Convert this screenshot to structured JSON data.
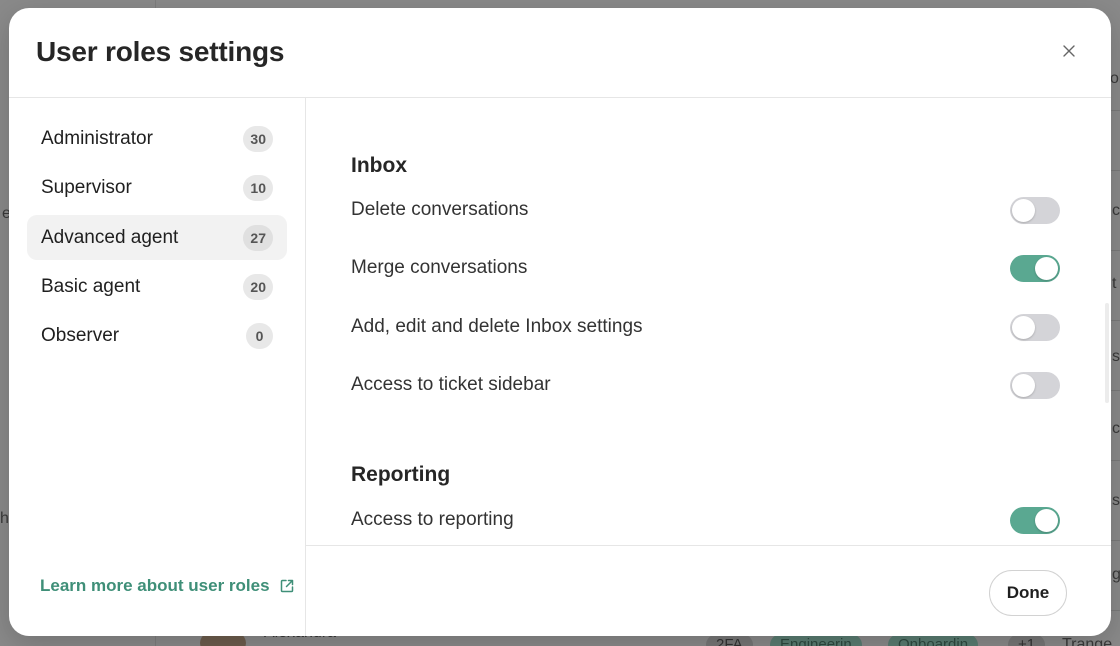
{
  "background": {
    "fragments": [
      "ol",
      "c",
      "t",
      "s",
      "c",
      "s",
      "g",
      "ha",
      "e"
    ],
    "row_name": "Alexandra",
    "tags": [
      "2FA",
      "Engineerin",
      "Onboardin",
      "+1",
      "Trange"
    ]
  },
  "modal": {
    "title": "User roles settings",
    "close_icon": "close-icon"
  },
  "sidebar": {
    "roles": [
      {
        "label": "Administrator",
        "count": "30",
        "active": false
      },
      {
        "label": "Supervisor",
        "count": "10",
        "active": false
      },
      {
        "label": "Advanced agent",
        "count": "27",
        "active": true
      },
      {
        "label": "Basic agent",
        "count": "20",
        "active": false
      },
      {
        "label": "Observer",
        "count": "0",
        "active": false
      }
    ],
    "learn_more": "Learn more about user roles",
    "learn_more_icon": "external-link-icon"
  },
  "content": {
    "sections": [
      {
        "title": "Inbox",
        "permissions": [
          {
            "label": "Delete conversations",
            "enabled": false
          },
          {
            "label": "Merge conversations",
            "enabled": true
          },
          {
            "label": "Add, edit and delete Inbox settings",
            "enabled": false
          },
          {
            "label": "Access to ticket sidebar",
            "enabled": false
          }
        ]
      },
      {
        "title": "Reporting",
        "permissions": [
          {
            "label": "Access to reporting",
            "enabled": true
          }
        ]
      }
    ]
  },
  "footer": {
    "done_label": "Done"
  },
  "colors": {
    "accent": "#5aa891",
    "link": "#3f8f78",
    "toggle_off": "#d4d4d8"
  }
}
